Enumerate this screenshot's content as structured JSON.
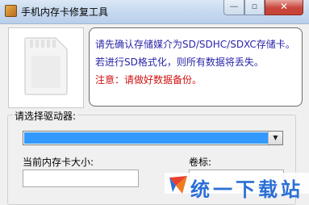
{
  "window": {
    "title": "手机内存卡修复工具",
    "minimize_glyph": "—",
    "maximize_glyph": "▫",
    "close_glyph": "✕"
  },
  "info": {
    "line1": "请先确认存储媒介为SD/SDHC/SDXC存储卡。",
    "line2": "若进行SD格式化，则所有数据将丢失。",
    "line3": "注意：请做好数据备份。"
  },
  "drive": {
    "group_label": "请选择驱动器:",
    "selected_value": "",
    "size_label": "当前内存卡大小:",
    "volume_label": "卷标:"
  },
  "watermark": {
    "text": "统一下载站"
  },
  "colors": {
    "info_text": "#2a25a8",
    "warning_text": "#d01010",
    "selection": "#3399ff"
  }
}
